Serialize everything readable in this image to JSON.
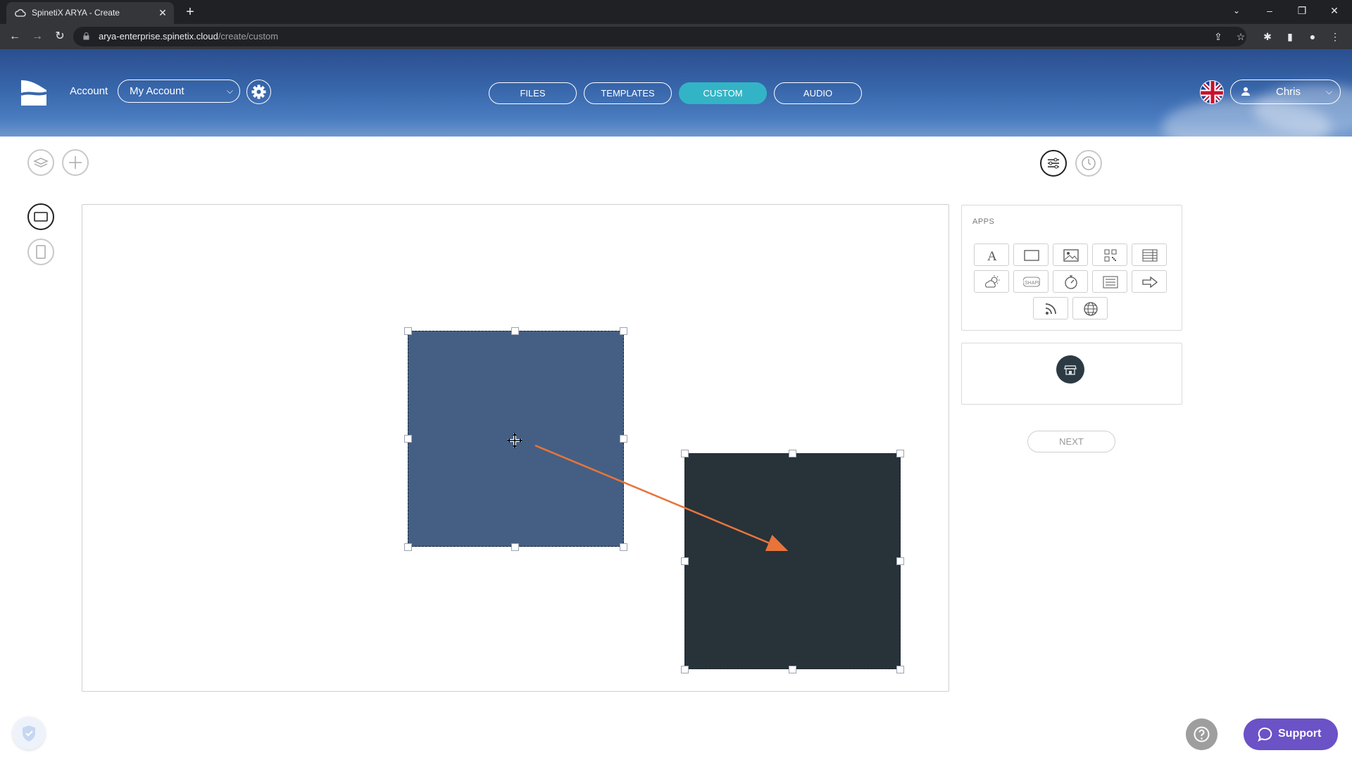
{
  "browser": {
    "tab_title": "SpinetiX ARYA - Create",
    "tab_close": "✕",
    "new_tab": "+",
    "url_host": "arya-enterprise.spinetix.cloud",
    "url_path": "/create/custom"
  },
  "header": {
    "account_label": "Account",
    "account_value": "My Account",
    "nav": [
      "FILES",
      "TEMPLATES",
      "CUSTOM",
      "AUDIO"
    ],
    "active_nav": "CUSTOM",
    "user_name": "Chris"
  },
  "canvas": {
    "shapes": [
      {
        "color": "#445f83"
      },
      {
        "color": "#273239"
      }
    ],
    "annotation_arrow_color": "#e8743b"
  },
  "apps_panel": {
    "title": "APPS",
    "apps": [
      "text-icon",
      "rectangle-icon",
      "image-icon",
      "qr-code-icon",
      "table-icon",
      "weather-icon",
      "shape-icon",
      "timer-icon",
      "list-icon",
      "arrow-right-icon",
      "rss-icon",
      "globe-icon"
    ]
  },
  "actions": {
    "next_label": "NEXT",
    "support_label": "Support"
  },
  "colors": {
    "accent": "#33b4c6",
    "support": "#6b52c6"
  }
}
